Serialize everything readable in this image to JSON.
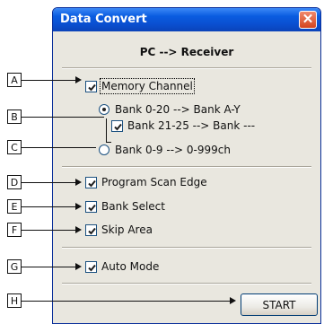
{
  "window": {
    "title": "Data Convert",
    "close_glyph": "✕",
    "header": "PC --> Receiver"
  },
  "options": {
    "memory_channel": {
      "label": "Memory Channel",
      "checked": true
    },
    "bank_a_radio": {
      "label": "Bank 0-20   -->  Bank A-Y",
      "selected": true
    },
    "bank_sub_check": {
      "label": "Bank 21-25   -->   Bank ---",
      "checked": true
    },
    "bank_c_radio": {
      "label": "Bank 0-9   -->  0-999ch",
      "selected": false
    },
    "program_scan_edge": {
      "label": "Program Scan Edge",
      "checked": true
    },
    "bank_select": {
      "label": "Bank Select",
      "checked": true
    },
    "skip_area": {
      "label": "Skip Area",
      "checked": true
    },
    "auto_mode": {
      "label": "Auto Mode",
      "checked": true
    }
  },
  "start_button": {
    "label": "START"
  },
  "callouts": [
    "A",
    "B",
    "C",
    "D",
    "E",
    "F",
    "G",
    "H"
  ],
  "colors": {
    "titlebar": "#0a4fd0",
    "window_bg": "#e9e7df",
    "close_button": "#d4441f"
  }
}
